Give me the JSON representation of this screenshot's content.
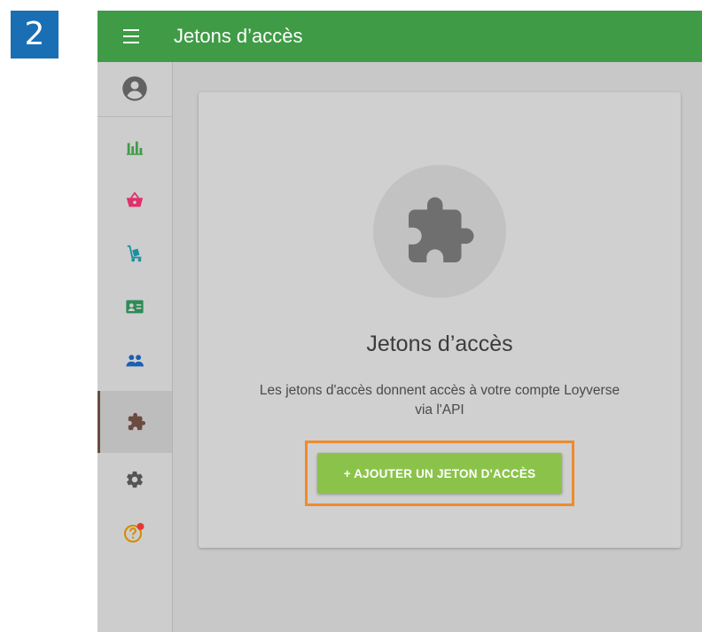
{
  "step_badge": "2",
  "header": {
    "title": "Jetons d’accès"
  },
  "sidebar": {
    "items": [
      {
        "name": "account",
        "icon": "account-circle-icon"
      },
      {
        "name": "reports",
        "icon": "bar-chart-icon",
        "color": "#3f9b46"
      },
      {
        "name": "sales",
        "icon": "shopping-basket-icon",
        "color": "#e0306b"
      },
      {
        "name": "items",
        "icon": "hand-truck-icon",
        "color": "#1a8fa0"
      },
      {
        "name": "employees",
        "icon": "id-card-icon",
        "color": "#2e8b57"
      },
      {
        "name": "customers",
        "icon": "people-icon",
        "color": "#1a5fb4"
      },
      {
        "name": "integrations",
        "icon": "puzzle-icon",
        "color": "#6b4a40",
        "active": true
      },
      {
        "name": "settings",
        "icon": "gear-icon",
        "color": "#555555"
      },
      {
        "name": "help",
        "icon": "help-icon",
        "color": "#d58a00",
        "notification_color": "#e53935"
      }
    ]
  },
  "main": {
    "card": {
      "icon": "puzzle-icon",
      "title": "Jetons d’accès",
      "description": "Les jetons d'accès donnent accès à votre compte Loyverse via l'API",
      "button_label": "+ AJOUTER UN JETON D'ACCÈS"
    }
  },
  "colors": {
    "header": "#3f9b46",
    "button": "#8bc34a",
    "highlight": "#f08a2c",
    "badge": "#1a6fb4"
  }
}
